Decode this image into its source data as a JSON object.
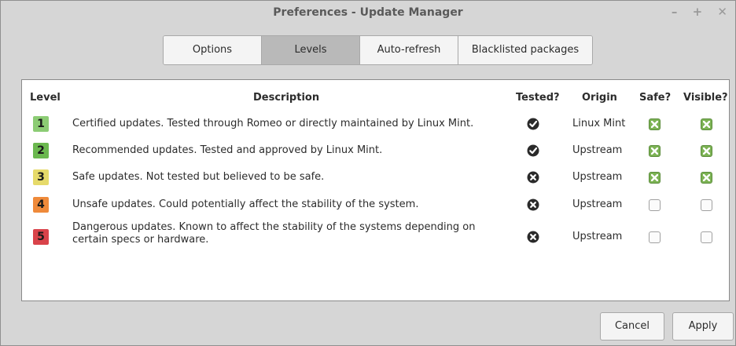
{
  "window": {
    "title": "Preferences - Update Manager",
    "controls": [
      "–",
      "+",
      "✕"
    ]
  },
  "tabs": [
    {
      "label": "Options",
      "active": false
    },
    {
      "label": "Levels",
      "active": true
    },
    {
      "label": "Auto-refresh",
      "active": false
    },
    {
      "label": "Blacklisted packages",
      "active": false
    }
  ],
  "table": {
    "headers": {
      "level": "Level",
      "description": "Description",
      "tested": "Tested?",
      "origin": "Origin",
      "safe": "Safe?",
      "visible": "Visible?"
    },
    "rows": [
      {
        "level": "1",
        "level_color": "#8ccc74",
        "description": "Certified updates. Tested through Romeo or directly maintained by Linux Mint.",
        "tested": "check-icon",
        "origin": "Linux Mint",
        "safe": true,
        "visible": true
      },
      {
        "level": "2",
        "level_color": "#6bb84f",
        "description": "Recommended updates. Tested and approved by Linux Mint.",
        "tested": "check-icon",
        "origin": "Upstream",
        "safe": true,
        "visible": true
      },
      {
        "level": "3",
        "level_color": "#e6da6a",
        "description": "Safe updates. Not tested but believed to be safe.",
        "tested": "cross-icon",
        "origin": "Upstream",
        "safe": true,
        "visible": true
      },
      {
        "level": "4",
        "level_color": "#ef8a3a",
        "description": "Unsafe updates. Could potentially affect the stability of the system.",
        "tested": "cross-icon",
        "origin": "Upstream",
        "safe": false,
        "visible": false
      },
      {
        "level": "5",
        "level_color": "#d9434a",
        "description": "Dangerous updates. Known to affect the stability of the systems depending on certain specs or hardware.",
        "tested": "cross-icon",
        "origin": "Upstream",
        "safe": false,
        "visible": false
      }
    ]
  },
  "buttons": {
    "cancel": "Cancel",
    "apply": "Apply"
  }
}
